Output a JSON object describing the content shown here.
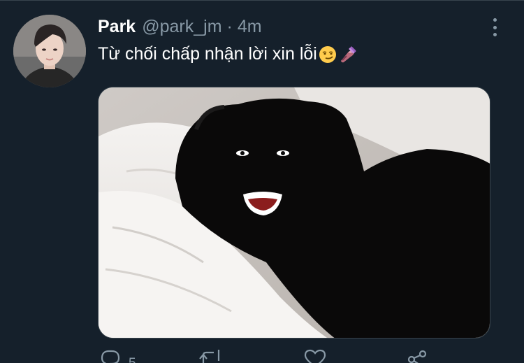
{
  "tweet": {
    "author_name": "Park",
    "handle": "@park_jm",
    "separator": "·",
    "time": "4m",
    "text": "Từ chối chấp nhận lời xin lỗi"
  },
  "actions": {
    "reply_count": "5"
  },
  "icons": {
    "more": "more-vertical-icon",
    "reply": "reply-icon",
    "retweet": "retweet-icon",
    "like": "heart-icon",
    "share": "share-icon",
    "emoji_1": "smirking-face-emoji",
    "emoji_2": "nail-polish-emoji"
  },
  "colors": {
    "background": "#15202b",
    "primary_text": "#ffffff",
    "secondary_text": "#8899a6",
    "divider": "#38444d"
  }
}
